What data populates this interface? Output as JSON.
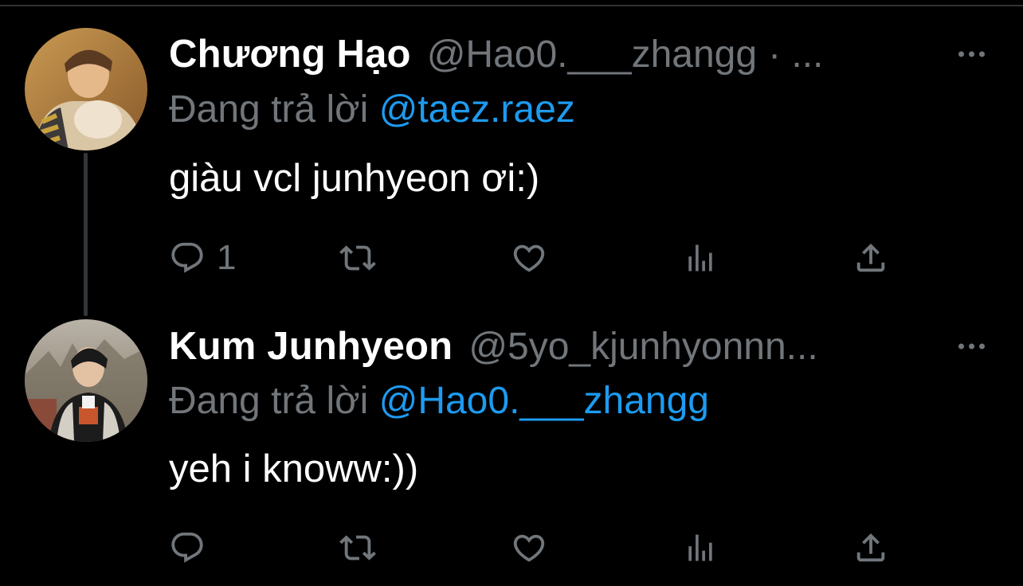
{
  "tweets": [
    {
      "display_name": "Chương Hạo",
      "handle": "@Hao0.___zhangg",
      "separator": "· ...",
      "replying_prefix": "Đang trả lời",
      "replying_to": "@taez.raez",
      "text": "giàu vcl junhyeon ơi:)",
      "reply_count": "1",
      "avatar_icon": "avatar-photo"
    },
    {
      "display_name": "Kum Junhyeon",
      "handle": "@5yo_kjunhyonnn...",
      "separator": "",
      "replying_prefix": "Đang trả lời",
      "replying_to": "@Hao0.___zhangg",
      "text": "yeh i knoww:))",
      "reply_count": "",
      "avatar_icon": "avatar-photo"
    }
  ],
  "icons": {
    "reply": "reply-icon",
    "retweet": "retweet-icon",
    "like": "heart-icon",
    "views": "views-icon",
    "share": "share-icon",
    "more": "more-icon"
  },
  "colors": {
    "background": "#000000",
    "text": "#ffffff",
    "muted": "#71767b",
    "link": "#1d9bf0"
  }
}
